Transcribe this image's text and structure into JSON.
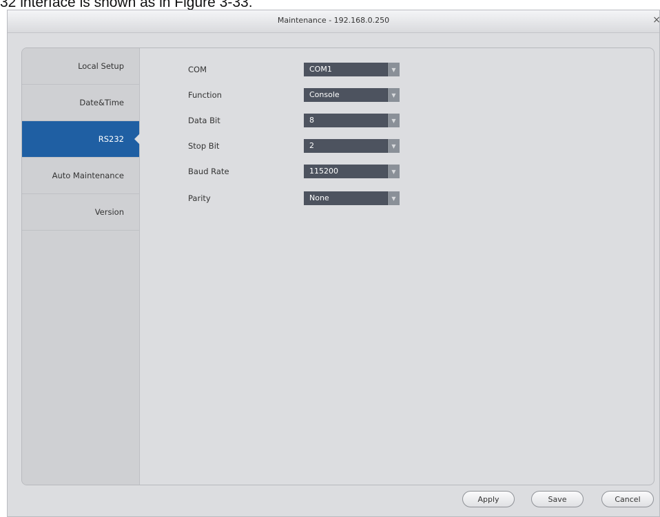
{
  "document": {
    "caption": "32 interface is shown as in Figure 3-33."
  },
  "window": {
    "title": "Maintenance - 192.168.0.250",
    "close_glyph": "×"
  },
  "sidebar": {
    "items": [
      {
        "label": "Local Setup"
      },
      {
        "label": "Date&Time"
      },
      {
        "label": "RS232"
      },
      {
        "label": "Auto Maintenance"
      },
      {
        "label": "Version"
      }
    ],
    "active": "RS232"
  },
  "form": {
    "fields": [
      {
        "label": "COM",
        "value": "COM1"
      },
      {
        "label": "Function",
        "value": "Console"
      },
      {
        "label": "Data Bit",
        "value": "8"
      },
      {
        "label": "Stop Bit",
        "value": "2"
      },
      {
        "label": "Baud Rate",
        "value": "115200"
      },
      {
        "label": "Parity",
        "value": "None"
      }
    ],
    "dropdown_glyph": "▼"
  },
  "footer": {
    "apply_label": "Apply",
    "save_label": "Save",
    "cancel_label": "Cancel"
  },
  "colors": {
    "accent": "#1f5fa3",
    "select_bg": "#4d535f",
    "background": "#dcdde0"
  }
}
